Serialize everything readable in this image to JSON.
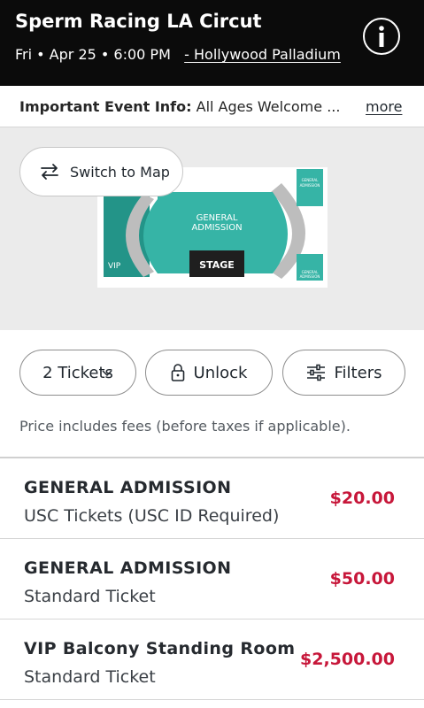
{
  "event": {
    "title": "Sperm Racing LA Circut",
    "date_time": "Fri • Apr 25 • 6:00 PM",
    "venue": " - Hollywood Palladium"
  },
  "info": {
    "label": "Important Event Info:",
    "text": "All Ages Welcome ...",
    "more": "more"
  },
  "map": {
    "switch_label": "Switch to Map",
    "ga_label_1": "GENERAL",
    "ga_label_2": "ADMISSION",
    "stage_label": "STAGE",
    "vip_label": "VIP",
    "side_ga_top_1": "GENERAL",
    "side_ga_top_2": "ADMISSION",
    "side_ga_bottom_1": "GENERAL",
    "side_ga_bottom_2": "ADMISSION",
    "teal": "#36b4a6",
    "dark_teal": "#239488"
  },
  "filters": {
    "tickets": "2 Tickets",
    "unlock": "Unlock",
    "filters": "Filters"
  },
  "fees_note": "Price includes fees (before taxes if applicable).",
  "listings": [
    {
      "name": "GENERAL ADMISSION",
      "sub": "USC Tickets (USC ID Required)",
      "price": "$20.00"
    },
    {
      "name": "GENERAL ADMISSION",
      "sub": "Standard Ticket",
      "price": "$50.00"
    },
    {
      "name": "VIP Balcony Standing Room",
      "sub": "Standard Ticket",
      "price": "$2,500.00"
    }
  ]
}
